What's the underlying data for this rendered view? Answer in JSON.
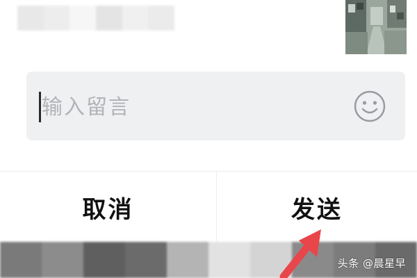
{
  "comment": {
    "placeholder": "输入留言",
    "value": "",
    "emoji_icon": "smiley-face-icon"
  },
  "actions": {
    "cancel_label": "取消",
    "send_label": "发送"
  },
  "watermark": {
    "text": "头条 @晨星早"
  },
  "colors": {
    "input_background": "#eff0f2",
    "placeholder": "#b3b3b8",
    "button_text": "#111111",
    "arrow": "#e8464a",
    "divider": "#eeeeee"
  },
  "icons": [
    "smiley-face-icon",
    "pointer-arrow-icon"
  ]
}
